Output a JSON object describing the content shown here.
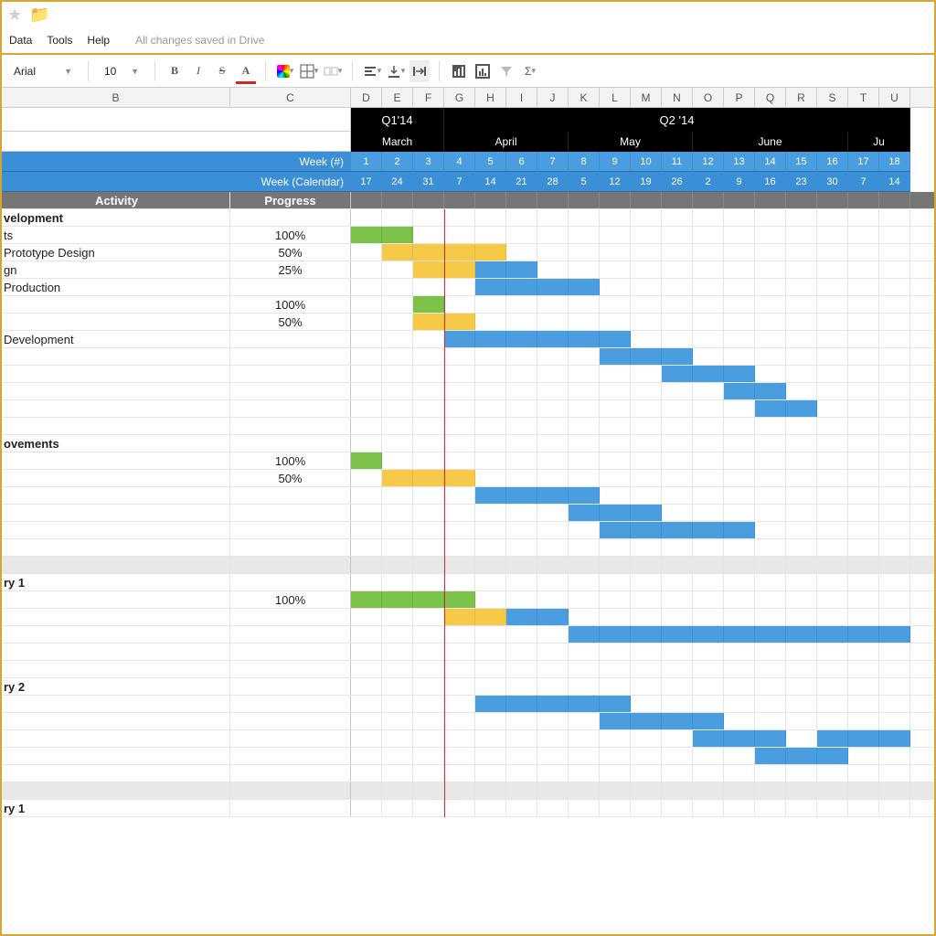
{
  "titlebar": {
    "star": "★",
    "folder": "▣"
  },
  "menu": {
    "data": "Data",
    "tools": "Tools",
    "help": "Help",
    "saved": "All changes saved in Drive"
  },
  "toolbar": {
    "font": "Arial",
    "size": "10",
    "bold": "B",
    "italic": "I",
    "strike": "S",
    "textcolor": "A"
  },
  "colheads": {
    "B": "B",
    "C": "C",
    "letters": [
      "D",
      "E",
      "F",
      "G",
      "H",
      "I",
      "J",
      "K",
      "L",
      "M",
      "N",
      "O",
      "P",
      "Q",
      "R",
      "S",
      "T",
      "U"
    ]
  },
  "quarters": [
    {
      "label": "Q1'14",
      "span": 3
    },
    {
      "label": "Q2 '14",
      "span": 15
    }
  ],
  "months": [
    {
      "label": "March",
      "span": 3
    },
    {
      "label": "April",
      "span": 4
    },
    {
      "label": "May",
      "span": 4
    },
    {
      "label": "June",
      "span": 5
    },
    {
      "label": "Ju",
      "span": 2
    }
  ],
  "week_label": "Week (#)",
  "cal_label": "Week (Calendar)",
  "week_nums": [
    "1",
    "2",
    "3",
    "4",
    "5",
    "6",
    "7",
    "8",
    "9",
    "10",
    "11",
    "12",
    "13",
    "14",
    "15",
    "16",
    "17",
    "18"
  ],
  "cal_nums": [
    "17",
    "24",
    "31",
    "7",
    "14",
    "21",
    "28",
    "5",
    "12",
    "19",
    "26",
    "2",
    "9",
    "16",
    "23",
    "30",
    "7",
    "14"
  ],
  "header_row": {
    "activity": "Activity",
    "progress": "Progress"
  },
  "chart_data": {
    "type": "gantt",
    "today_column_index": 3,
    "sections": [
      {
        "name": "velopment",
        "rows": [
          {
            "activity": "ts",
            "progress": "100%",
            "bars": [
              {
                "start": 0,
                "end": 2,
                "color": "green"
              }
            ]
          },
          {
            "activity": "Prototype Design",
            "progress": "50%",
            "bars": [
              {
                "start": 1,
                "end": 3,
                "color": "yellow"
              },
              {
                "start": 3,
                "end": 5,
                "color": "yellow"
              }
            ]
          },
          {
            "activity": "gn",
            "progress": "25%",
            "bars": [
              {
                "start": 2,
                "end": 4,
                "color": "yellow"
              },
              {
                "start": 4,
                "end": 6,
                "color": "blue"
              }
            ]
          },
          {
            "activity": "Production",
            "progress": "",
            "bars": [
              {
                "start": 4,
                "end": 8,
                "color": "blue"
              }
            ]
          },
          {
            "activity": "",
            "progress": "100%",
            "bars": [
              {
                "start": 2,
                "end": 3,
                "color": "green"
              }
            ]
          },
          {
            "activity": "",
            "progress": "50%",
            "bars": [
              {
                "start": 2,
                "end": 4,
                "color": "yellow"
              }
            ]
          },
          {
            "activity": "Development",
            "progress": "",
            "bars": [
              {
                "start": 3,
                "end": 9,
                "color": "blue"
              }
            ]
          },
          {
            "activity": "",
            "progress": "",
            "bars": [
              {
                "start": 8,
                "end": 11,
                "color": "blue"
              }
            ]
          },
          {
            "activity": "",
            "progress": "",
            "bars": [
              {
                "start": 10,
                "end": 13,
                "color": "blue"
              }
            ]
          },
          {
            "activity": "",
            "progress": "",
            "bars": [
              {
                "start": 12,
                "end": 14,
                "color": "blue"
              }
            ]
          },
          {
            "activity": "",
            "progress": "",
            "bars": [
              {
                "start": 13,
                "end": 15,
                "color": "blue"
              }
            ]
          },
          {
            "activity": "",
            "progress": "",
            "bars": []
          }
        ]
      },
      {
        "name": "ovements",
        "rows": [
          {
            "activity": "",
            "progress": "100%",
            "bars": [
              {
                "start": 0,
                "end": 1,
                "color": "green"
              }
            ]
          },
          {
            "activity": "",
            "progress": "50%",
            "bars": [
              {
                "start": 1,
                "end": 4,
                "color": "yellow"
              }
            ]
          },
          {
            "activity": "",
            "progress": "",
            "bars": [
              {
                "start": 4,
                "end": 8,
                "color": "blue"
              }
            ]
          },
          {
            "activity": "",
            "progress": "",
            "bars": [
              {
                "start": 7,
                "end": 10,
                "color": "blue"
              }
            ]
          },
          {
            "activity": "",
            "progress": "",
            "bars": [
              {
                "start": 8,
                "end": 13,
                "color": "blue"
              }
            ]
          },
          {
            "activity": "",
            "progress": "",
            "bars": []
          }
        ],
        "followed_by_gap": true
      },
      {
        "name": "ry 1",
        "rows": [
          {
            "activity": "",
            "progress": "100%",
            "bars": [
              {
                "start": 0,
                "end": 4,
                "color": "green"
              }
            ]
          },
          {
            "activity": "",
            "progress": "",
            "bars": [
              {
                "start": 3,
                "end": 5,
                "color": "yellow"
              },
              {
                "start": 5,
                "end": 7,
                "color": "blue"
              }
            ]
          },
          {
            "activity": "",
            "progress": "",
            "bars": [
              {
                "start": 7,
                "end": 18,
                "color": "blue"
              }
            ]
          },
          {
            "activity": "",
            "progress": "",
            "bars": []
          },
          {
            "activity": "",
            "progress": "",
            "bars": []
          }
        ]
      },
      {
        "name": "ry 2",
        "rows": [
          {
            "activity": "",
            "progress": "",
            "bars": [
              {
                "start": 4,
                "end": 9,
                "color": "blue"
              }
            ]
          },
          {
            "activity": "",
            "progress": "",
            "bars": [
              {
                "start": 8,
                "end": 12,
                "color": "blue"
              }
            ]
          },
          {
            "activity": "",
            "progress": "",
            "bars": [
              {
                "start": 11,
                "end": 14,
                "color": "blue"
              },
              {
                "start": 15,
                "end": 18,
                "color": "blue"
              }
            ]
          },
          {
            "activity": "",
            "progress": "",
            "bars": [
              {
                "start": 13,
                "end": 16,
                "color": "blue"
              }
            ]
          },
          {
            "activity": "",
            "progress": "",
            "bars": []
          }
        ],
        "followed_by_gap": true
      },
      {
        "name": "ry 1",
        "rows": []
      }
    ]
  }
}
